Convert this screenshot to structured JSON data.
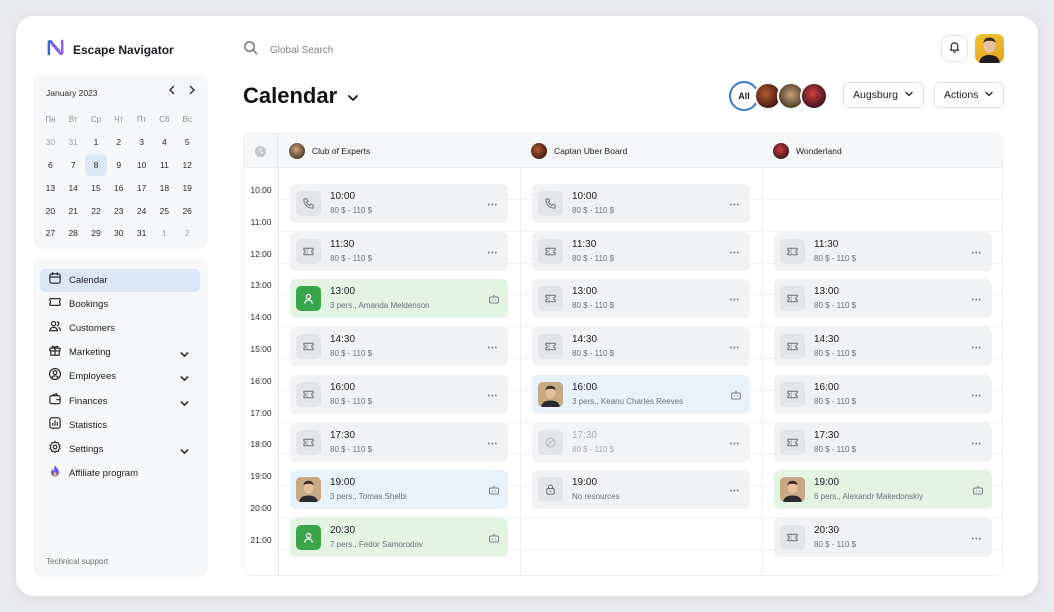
{
  "brand": {
    "name": "Escape Navigator",
    "logo_icon": "logo-n-icon"
  },
  "search": {
    "placeholder": "Global Search"
  },
  "mini_calendar": {
    "month": "January 2023",
    "weekdays": [
      "Пн",
      "Вт",
      "Ср",
      "Чт",
      "Пт",
      "Сб",
      "Вс"
    ],
    "rows": [
      [
        "30",
        "31",
        "1",
        "2",
        "3",
        "4",
        "5"
      ],
      [
        "6",
        "7",
        "8",
        "9",
        "10",
        "11",
        "12"
      ],
      [
        "13",
        "14",
        "15",
        "16",
        "17",
        "18",
        "19"
      ],
      [
        "20",
        "21",
        "22",
        "23",
        "24",
        "25",
        "26"
      ],
      [
        "27",
        "28",
        "29",
        "30",
        "31",
        "1",
        "2"
      ]
    ],
    "selected": "8"
  },
  "nav": {
    "items": [
      {
        "label": "Calendar",
        "icon": "calendar-icon",
        "active": true,
        "expandable": false
      },
      {
        "label": "Bookings",
        "icon": "ticket-icon",
        "active": false,
        "expandable": false
      },
      {
        "label": "Customers",
        "icon": "users-icon",
        "active": false,
        "expandable": false
      },
      {
        "label": "Marketing",
        "icon": "gift-icon",
        "active": false,
        "expandable": true
      },
      {
        "label": "Employees",
        "icon": "user-circle-icon",
        "active": false,
        "expandable": true
      },
      {
        "label": "Finances",
        "icon": "wallet-icon",
        "active": false,
        "expandable": true
      },
      {
        "label": "Statistics",
        "icon": "chart-icon",
        "active": false,
        "expandable": false
      },
      {
        "label": "Settings",
        "icon": "gear-icon",
        "active": false,
        "expandable": true
      },
      {
        "label": "Affiliate program",
        "icon": "flame-icon",
        "active": false,
        "expandable": false
      }
    ],
    "support": "Technical support"
  },
  "header": {
    "title": "Calendar",
    "filter_all": "All",
    "location": "Augsburg",
    "actions": "Actions"
  },
  "calendar": {
    "times": [
      "10:00",
      "11:00",
      "12:00",
      "13:00",
      "14:00",
      "15:00",
      "16:00",
      "17:00",
      "18:00",
      "19:00",
      "20:00",
      "21:00"
    ],
    "rooms": [
      {
        "name": "Club of Experts",
        "slots": [
          {
            "time": "10:00",
            "sub": "80 $ - 110 $",
            "kind": "phone"
          },
          {
            "time": "11:30",
            "sub": "80 $ - 110 $",
            "kind": "ticket"
          },
          {
            "time": "13:00",
            "sub": "3 pers., Amanda Meldenson",
            "kind": "booked"
          },
          {
            "time": "14:30",
            "sub": "80 $ - 110 $",
            "kind": "ticket"
          },
          {
            "time": "16:00",
            "sub": "80 $ - 110 $",
            "kind": "ticket"
          },
          {
            "time": "17:30",
            "sub": "80 $ - 110 $",
            "kind": "ticket"
          },
          {
            "time": "19:00",
            "sub": "3 pers., Tomas Shelbi",
            "kind": "photo-blue"
          },
          {
            "time": "20:30",
            "sub": "7 pers., Fedor Samorodov",
            "kind": "booked"
          }
        ]
      },
      {
        "name": "Captan Uber Board",
        "slots": [
          {
            "time": "10:00",
            "sub": "80 $ - 110 $",
            "kind": "phone"
          },
          {
            "time": "11:30",
            "sub": "80 $ - 110 $",
            "kind": "ticket"
          },
          {
            "time": "13:00",
            "sub": "80 $ - 110 $",
            "kind": "ticket"
          },
          {
            "time": "14:30",
            "sub": "80 $ - 110 $",
            "kind": "ticket"
          },
          {
            "time": "16:00",
            "sub": "3 pers., Keanu Charles Reeves",
            "kind": "photo-blue"
          },
          {
            "time": "17:30",
            "sub": "80 $ - 110 $",
            "kind": "blocked"
          },
          {
            "time": "19:00",
            "sub": "No resources",
            "kind": "lock"
          }
        ]
      },
      {
        "name": "Wonderland",
        "slots": [
          {
            "time": "11:30",
            "sub": "80 $ - 110 $",
            "kind": "ticket"
          },
          {
            "time": "13:00",
            "sub": "80 $ - 110 $",
            "kind": "ticket"
          },
          {
            "time": "14:30",
            "sub": "80 $ - 110 $",
            "kind": "ticket"
          },
          {
            "time": "16:00",
            "sub": "80 $ - 110 $",
            "kind": "ticket"
          },
          {
            "time": "17:30",
            "sub": "80 $ - 110 $",
            "kind": "ticket"
          },
          {
            "time": "19:00",
            "sub": "6 pers., Alexandr Makedonskiy",
            "kind": "photo-green"
          },
          {
            "time": "20:30",
            "sub": "80 $ - 110 $",
            "kind": "ticket"
          }
        ]
      }
    ]
  },
  "colors": {
    "accent": "#3a7bd5",
    "booked": "#3aa64a",
    "active_nav": "#dce7f6"
  }
}
